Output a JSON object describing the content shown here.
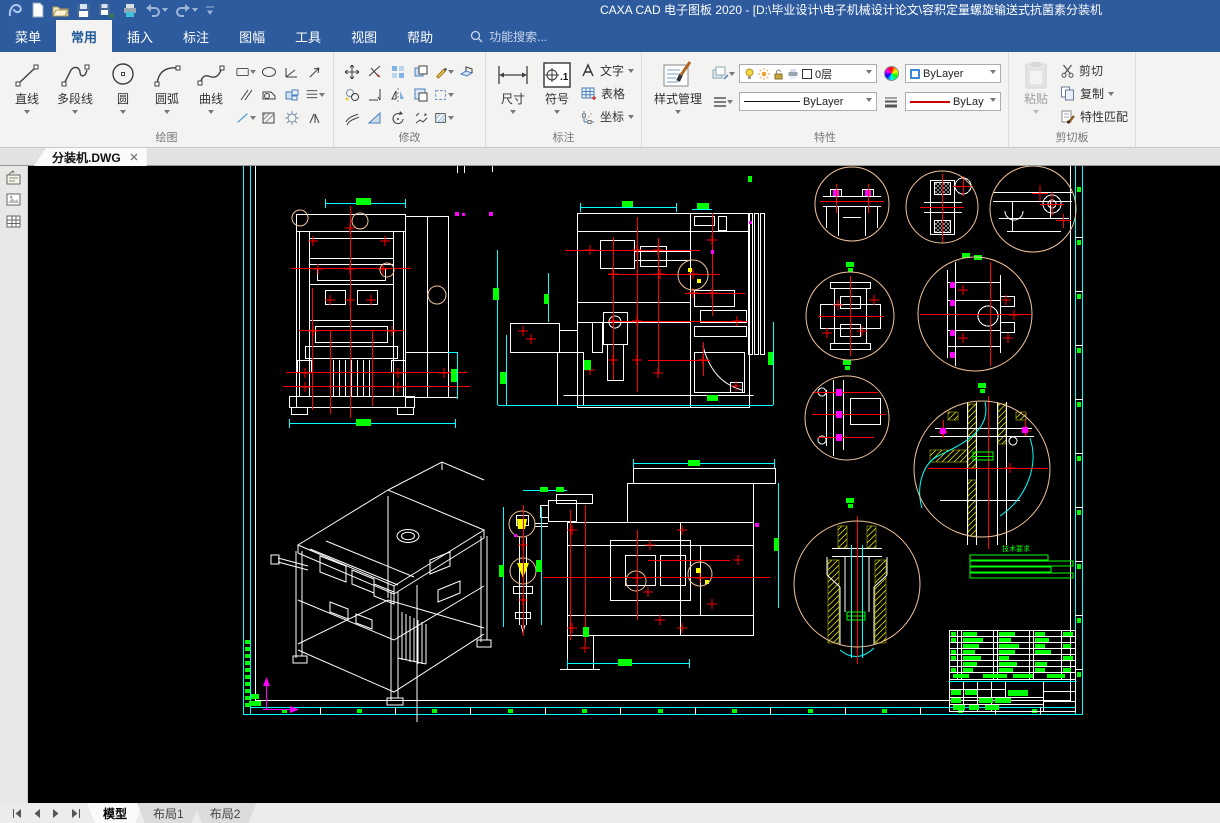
{
  "window": {
    "title": "CAXA CAD 电子图板 2020 - [D:\\毕业设计\\电子机械设计论文\\容积定量螺旋输送式抗菌素分装机"
  },
  "menu_tabs": [
    "菜单",
    "常用",
    "插入",
    "标注",
    "图幅",
    "工具",
    "视图",
    "帮助"
  ],
  "search": {
    "placeholder": "功能搜索..."
  },
  "ribbon": {
    "draw": {
      "label": "绘图",
      "buttons": [
        "直线",
        "多段线",
        "圆",
        "圆弧",
        "曲线"
      ]
    },
    "modify": {
      "label": "修改"
    },
    "annotate": {
      "label": "标注",
      "dimension": "尺寸",
      "symbol": "符号",
      "text": "文字",
      "table": "表格",
      "coordinate": "坐标"
    },
    "properties": {
      "label": "特性",
      "style_manager": "样式管理",
      "layer": "0层",
      "color": "ByLayer",
      "linetype": "ByLayer",
      "lineweight": "ByLay"
    },
    "clipboard": {
      "label": "剪切板",
      "paste": "粘贴",
      "cut": "剪切",
      "copy": "复制",
      "match": "特性匹配"
    }
  },
  "drawing": {
    "file_tab": "分装机.DWG",
    "notes_title": "技术要求"
  },
  "sheet_tabs": [
    "模型",
    "布局1",
    "布局2"
  ],
  "colors": {
    "titlebar": "#2d5b9e",
    "canvas": "#000000",
    "sheet_border": "#00ffff",
    "geometry": "#ffffff",
    "centerline": "#ff0000",
    "detail_circle": "#f0c49c",
    "hatch": "#ffff00",
    "dimension_text": "#00ff00",
    "mark": "#ff00ff"
  }
}
